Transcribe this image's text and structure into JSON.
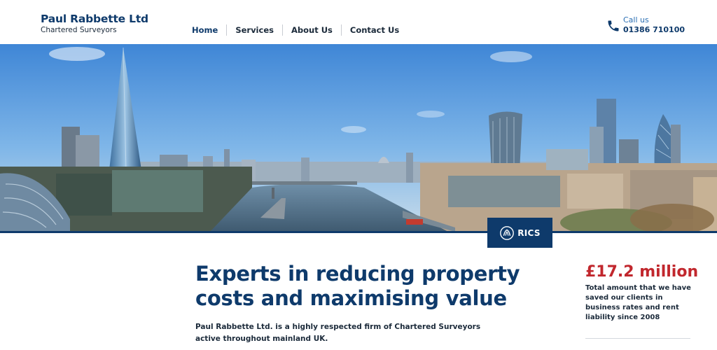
{
  "brand": {
    "name": "Paul Rabbette Ltd",
    "tagline": "Chartered Surveyors"
  },
  "nav": {
    "items": [
      {
        "label": "Home"
      },
      {
        "label": "Services"
      },
      {
        "label": "About Us"
      },
      {
        "label": "Contact Us"
      }
    ]
  },
  "contact": {
    "label": "Call us",
    "phone": "01386 710100",
    "icon": "phone-icon"
  },
  "hero": {
    "image": "london-skyline-panorama",
    "badge": "RICS"
  },
  "main": {
    "headline": "Experts in reducing property costs and maximising value",
    "intro": "Paul Rabbette Ltd. is a highly respected firm of Chartered Surveyors active throughout mainland UK."
  },
  "stat": {
    "value": "£17.2 million",
    "description": "Total amount that we have saved our clients in business rates and rent liability since 2008"
  },
  "colors": {
    "brand_navy": "#0e3a6b",
    "accent_red": "#c1272d",
    "link_blue": "#2b6fb3"
  }
}
